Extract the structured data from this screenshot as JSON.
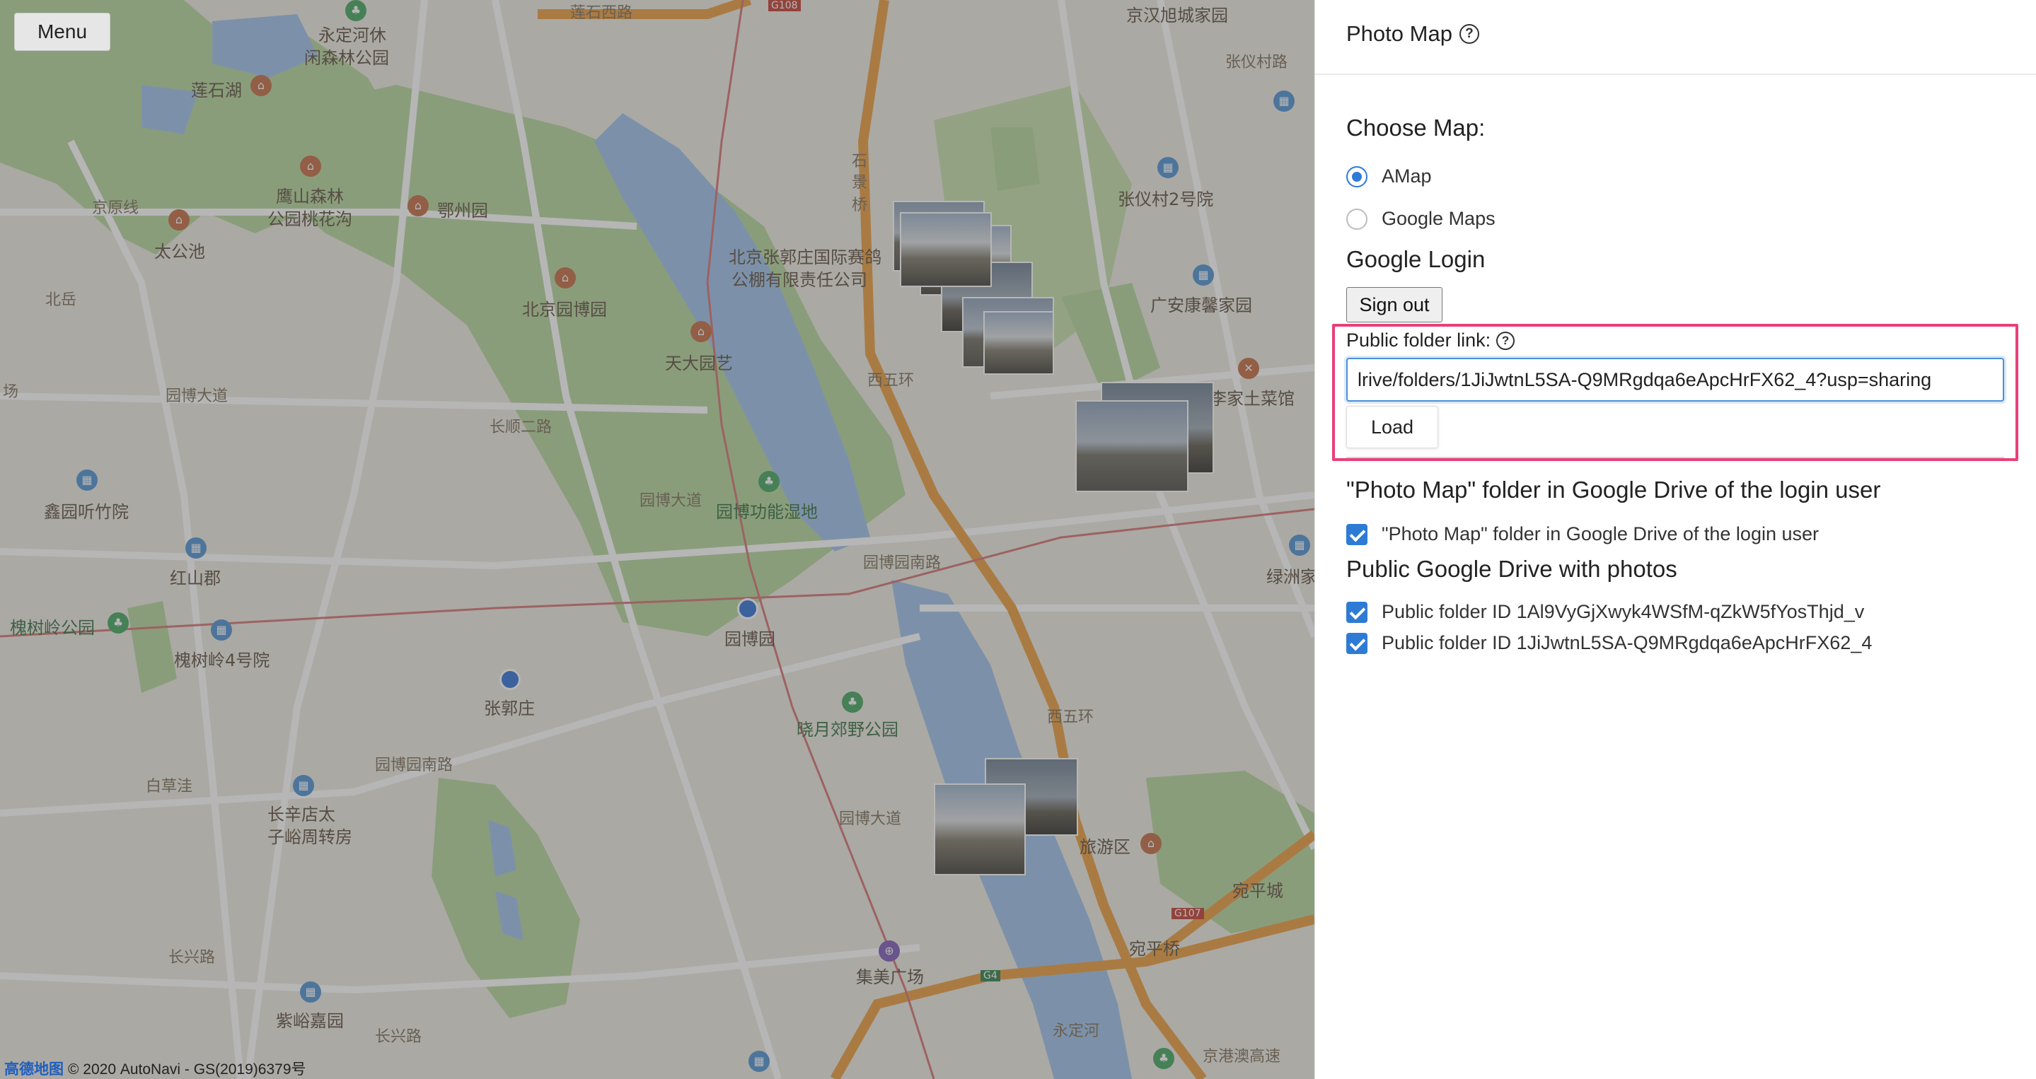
{
  "map": {
    "menu_label": "Menu",
    "copyright_logo": "高德地图",
    "copyright_text": "© 2020 AutoNavi - GS(2019)6379号",
    "labels": {
      "l1": "莲石西路",
      "l2": "永定河休",
      "l3": "闲森林公园",
      "l4": "京汉旭城家园",
      "l5": "莲石湖",
      "l6": "石",
      "l7": "景",
      "l8": "桥",
      "l9": "张仪村2号院",
      "l10": "京原线",
      "l11": "鹰山森林",
      "l12": "公园桃花沟",
      "l13": "鄂州园",
      "l14": "太公池",
      "l15": "北京张郭庄国际赛鸽",
      "l16": "公棚有限责任公司",
      "l17": "北京园博园",
      "l18": "广安康馨家园",
      "l19": "北岳",
      "l20": "天大园艺",
      "l21": "西五环",
      "l22": "李家土菜馆",
      "l23": "场",
      "l24": "园博大道",
      "l25": "长顺二路",
      "l26": "鑫园听竹院",
      "l27": "园博大道",
      "l28": "园博功能湿地",
      "l29": "红山郡",
      "l30": "园博园南路",
      "l31": "槐树岭公园",
      "l32": "槐树岭4号院",
      "l33": "园博园",
      "l34": "张郭庄",
      "l35": "绿洲家",
      "l36": "晓月郊野公园",
      "l37": "西五环",
      "l38": "白草洼",
      "l39": "园博园南路",
      "l40": "长辛店太",
      "l41": "子峪周转房",
      "l42": "园博大道",
      "l43": "旅游区",
      "l44": "宛平城",
      "l45": "长兴路",
      "l46": "集美广场",
      "l47": "宛平桥",
      "l48": "紫峪嘉园",
      "l49": "长兴路",
      "l50": "永定河",
      "l51": "张仪村路",
      "l52": "G108",
      "l53": "G107",
      "l54": "G4",
      "l55": "京港澳高速"
    }
  },
  "panel": {
    "title": "Photo Map",
    "help_icon": "question-circle-icon",
    "choose_map_heading": "Choose Map:",
    "map_options": [
      "AMap",
      "Google Maps"
    ],
    "selected_map": "AMap",
    "google_login_heading": "Google Login",
    "sign_out_label": "Sign out",
    "public_folder_label": "Public folder link:",
    "public_folder_value": "lrive/folders/1JiJwtnL5SA-Q9MRgdqa6eApcHrFX62_4?usp=sharing",
    "load_label": "Load",
    "login_folder_heading": "\"Photo Map\" folder in Google Drive of the login user",
    "login_folder_checkbox": "\"Photo Map\" folder in Google Drive of the login user",
    "public_drive_heading": "Public Google Drive with photos",
    "public_folders": [
      "Public folder ID 1Al9VyGjXwyk4WSfM-qZkW5fYosThjd_v",
      "Public folder ID 1JiJwtnL5SA-Q9MRgdqa6eApcHrFX62_4"
    ]
  },
  "colors": {
    "accent": "#2e7bd6",
    "highlight": "#e8407a",
    "park_green": "#a9cf8a",
    "water": "#9cc0e8",
    "road_orange": "#f0a23a"
  }
}
